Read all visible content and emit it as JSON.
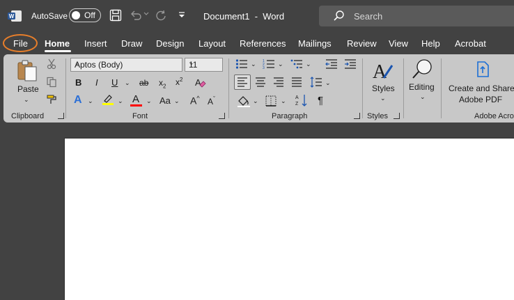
{
  "titlebar": {
    "autosave_label": "AutoSave",
    "autosave_state": "Off",
    "document_title": "Document1  -  Word",
    "search_placeholder": "Search",
    "icons": [
      "word-logo-icon",
      "save-icon",
      "undo-icon",
      "redo-icon",
      "customize-qat-icon",
      "search-icon"
    ]
  },
  "tabs": [
    "File",
    "Home",
    "Insert",
    "Draw",
    "Design",
    "Layout",
    "References",
    "Mailings",
    "Review",
    "View",
    "Help",
    "Acrobat"
  ],
  "ribbon": {
    "clipboard": {
      "paste_label": "Paste",
      "group_label": "Clipboard"
    },
    "font": {
      "font_name": "Aptos (Body)",
      "font_size": "11",
      "bold": "B",
      "italic": "I",
      "underline": "U",
      "strike": "ab",
      "subscript": "x",
      "subscript_digit": "2",
      "superscript": "x",
      "superscript_digit": "2",
      "text_effects": "A",
      "font_color": "A",
      "change_case": "Aa",
      "grow": "A",
      "grow_mark": "^",
      "shrink": "A",
      "shrink_mark": "ˇ",
      "group_label": "Font",
      "highlight_color": "#ffff00",
      "font_color_bar": "#ff0000"
    },
    "paragraph": {
      "pilcrow": "¶",
      "group_label": "Paragraph"
    },
    "styles": {
      "label": "Styles",
      "group_label": "Styles"
    },
    "editing": {
      "label": "Editing"
    },
    "acrobat": {
      "label_line1": "Create and Share",
      "label_line2": "Adobe PDF",
      "group_label": "Adobe Acrobat"
    }
  },
  "colors": {
    "file_highlight": "#e77e2a",
    "ribbon_bg": "#c8c8c8",
    "titlebar_bg": "#424242"
  }
}
